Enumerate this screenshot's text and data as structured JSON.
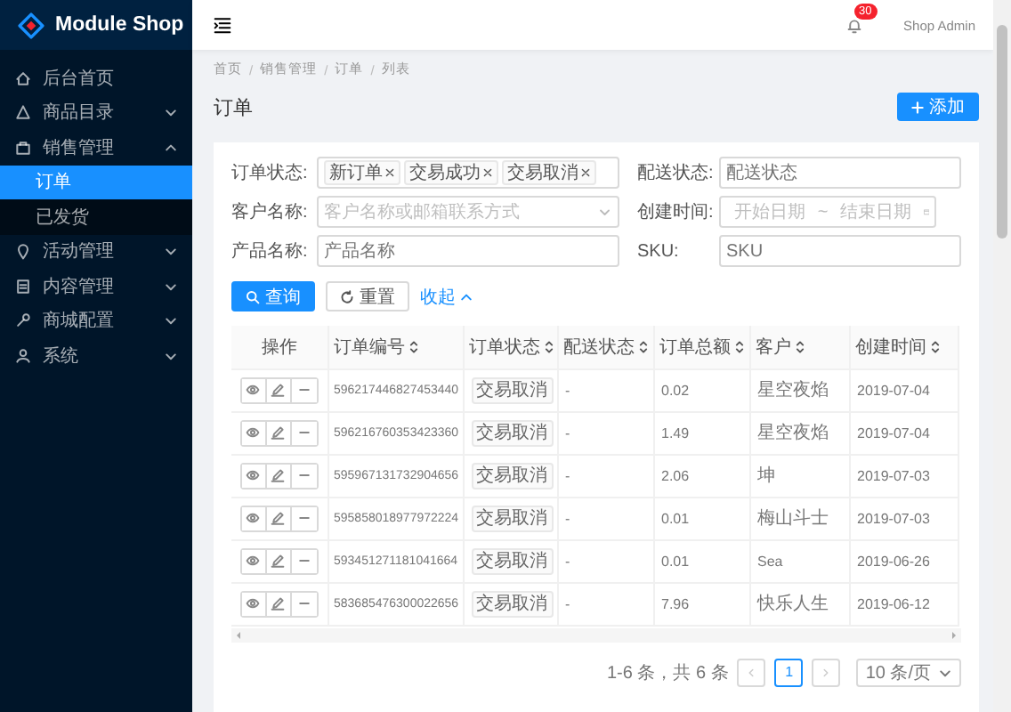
{
  "brand": {
    "name": "Module Shop"
  },
  "sidebar": {
    "items": [
      {
        "label": "后台首页"
      },
      {
        "label": "商品目录",
        "expanded": false
      },
      {
        "label": "销售管理",
        "expanded": true,
        "children": [
          {
            "label": "订单",
            "selected": true
          },
          {
            "label": "已发货",
            "selected": false
          }
        ]
      },
      {
        "label": "活动管理",
        "expanded": false
      },
      {
        "label": "内容管理",
        "expanded": false
      },
      {
        "label": "商城配置",
        "expanded": false
      },
      {
        "label": "系统",
        "expanded": false
      }
    ]
  },
  "header": {
    "notifications": "30",
    "user": "Shop Admin"
  },
  "breadcrumb": {
    "separator": "/",
    "items": [
      "首页",
      "销售管理",
      "订单",
      "列表"
    ]
  },
  "page_title": "订单",
  "add_button": "添加",
  "filters": [
    {
      "kind": "tags",
      "label": "订单状态:",
      "tags": [
        "新订单",
        "交易成功",
        "交易取消"
      ]
    },
    {
      "kind": "input",
      "label": "配送状态:",
      "placeholder": "配送状态"
    },
    {
      "kind": "select",
      "label": "客户名称:",
      "placeholder": "客户名称或邮箱联系方式"
    },
    {
      "kind": "date_range",
      "label": "创建时间:",
      "start_placeholder": "开始日期",
      "separator": "~",
      "end_placeholder": "结束日期"
    },
    {
      "kind": "input",
      "label": "产品名称:",
      "placeholder": "产品名称"
    },
    {
      "kind": "input",
      "label": "SKU:",
      "placeholder": "SKU"
    }
  ],
  "actions": {
    "search": "查询",
    "reset": "重置",
    "collapse": "收起"
  },
  "table": {
    "columns": [
      {
        "label": "操作",
        "sortable": false
      },
      {
        "label": "订单编号",
        "sortable": true
      },
      {
        "label": "订单状态",
        "sortable": true
      },
      {
        "label": "配送状态",
        "sortable": true
      },
      {
        "label": "订单总额",
        "sortable": true
      },
      {
        "label": "客户",
        "sortable": true
      },
      {
        "label": "创建时间",
        "sortable": true
      }
    ],
    "rows": [
      {
        "id": "596217446827453440",
        "status": "交易取消",
        "delivery": "-",
        "total": "0.02",
        "customer": "星空夜焰",
        "created": "2019-07-04"
      },
      {
        "id": "596216760353423360",
        "status": "交易取消",
        "delivery": "-",
        "total": "1.49",
        "customer": "星空夜焰",
        "created": "2019-07-04"
      },
      {
        "id": "595967131732904656",
        "status": "交易取消",
        "delivery": "-",
        "total": "2.06",
        "customer": "坤",
        "created": "2019-07-03"
      },
      {
        "id": "595858018977972224",
        "status": "交易取消",
        "delivery": "-",
        "total": "0.01",
        "customer": "梅山斗士",
        "created": "2019-07-03"
      },
      {
        "id": "593451271181041664",
        "status": "交易取消",
        "delivery": "-",
        "total": "0.01",
        "customer": "Sea",
        "created": "2019-06-26"
      },
      {
        "id": "583685476300022656",
        "status": "交易取消",
        "delivery": "-",
        "total": "7.96",
        "customer": "快乐人生",
        "created": "2019-06-12"
      }
    ]
  },
  "pagination": {
    "summary": "1-6 条，共 6 条",
    "prev": {
      "disabled": true
    },
    "pages": [
      {
        "label": "1",
        "selected": true
      }
    ],
    "next": {
      "disabled": true
    },
    "page_size": "10 条/页"
  }
}
